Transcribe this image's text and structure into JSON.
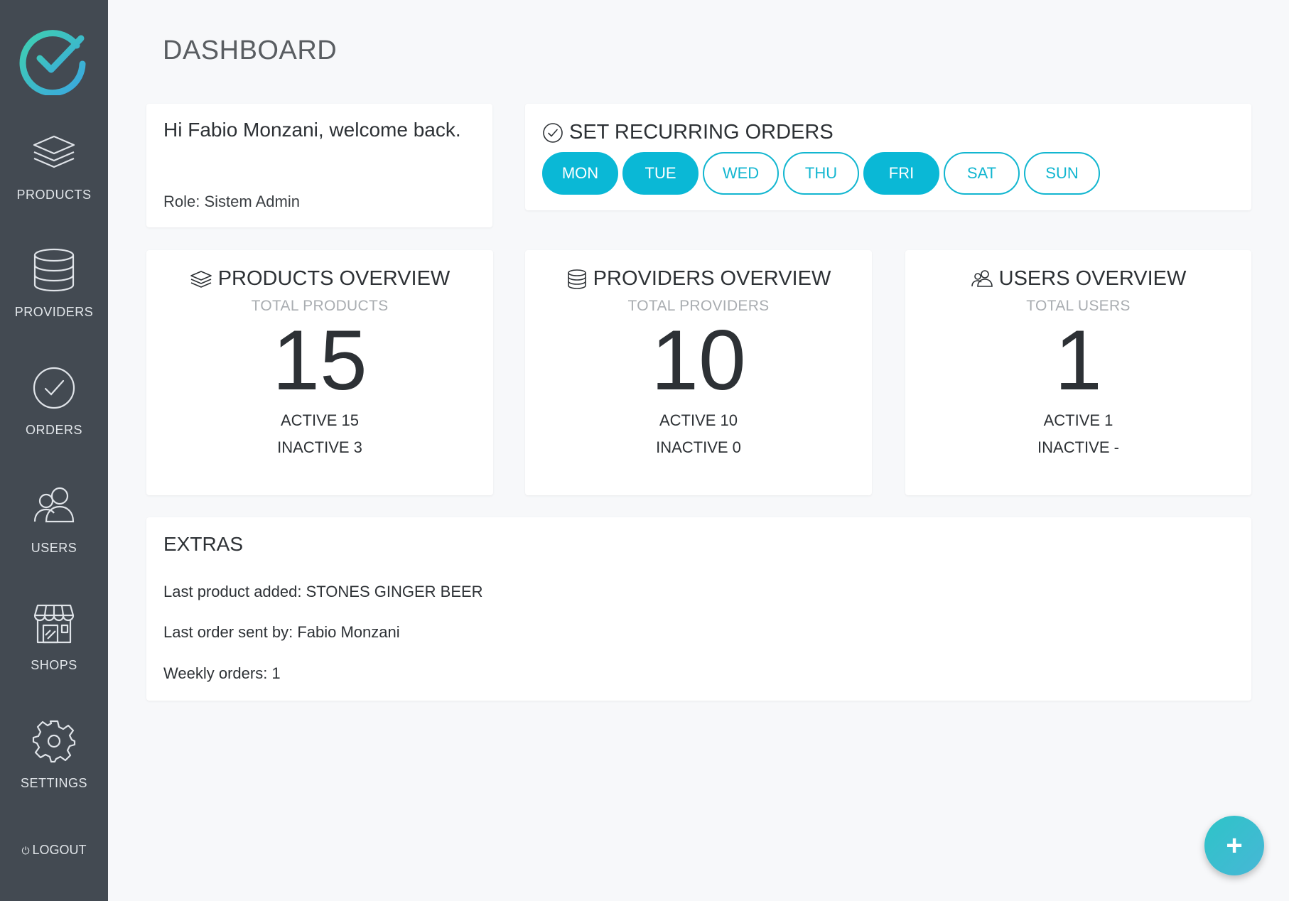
{
  "page": {
    "title": "DASHBOARD"
  },
  "sidebar": {
    "items": [
      {
        "label": "PRODUCTS",
        "icon": "layers-icon"
      },
      {
        "label": "PROVIDERS",
        "icon": "database-icon"
      },
      {
        "label": "ORDERS",
        "icon": "check-circle-icon"
      },
      {
        "label": "USERS",
        "icon": "users-icon"
      },
      {
        "label": "SHOPS",
        "icon": "shop-icon"
      },
      {
        "label": "SETTINGS",
        "icon": "gear-icon"
      }
    ],
    "logout": "LOGOUT"
  },
  "welcome": {
    "greeting": "Hi Fabio Monzani, welcome back.",
    "role": "Role: Sistem Admin"
  },
  "recurring": {
    "title": "SET RECURRING ORDERS",
    "days": [
      {
        "label": "MON",
        "selected": true
      },
      {
        "label": "TUE",
        "selected": true
      },
      {
        "label": "WED",
        "selected": false
      },
      {
        "label": "THU",
        "selected": false
      },
      {
        "label": "FRI",
        "selected": true
      },
      {
        "label": "SAT",
        "selected": false
      },
      {
        "label": "SUN",
        "selected": false
      }
    ]
  },
  "overview": {
    "products": {
      "title": "PRODUCTS OVERVIEW",
      "subtitle": "TOTAL PRODUCTS",
      "total": "15",
      "active": "ACTIVE 15",
      "inactive": "INACTIVE 3"
    },
    "providers": {
      "title": "PROVIDERS OVERVIEW",
      "subtitle": "TOTAL PROVIDERS",
      "total": "10",
      "active": "ACTIVE 10",
      "inactive": "INACTIVE 0"
    },
    "users": {
      "title": "USERS OVERVIEW",
      "subtitle": "TOTAL USERS",
      "total": "1",
      "active": "ACTIVE 1",
      "inactive": "INACTIVE -"
    }
  },
  "extras": {
    "title": "EXTRAS",
    "last_product": "Last product added: STONES GINGER BEER",
    "last_order": "Last order sent by: Fabio Monzani",
    "weekly_orders": "Weekly orders: 1"
  },
  "fab": {
    "label": "+"
  },
  "colors": {
    "accent": "#0ab8d6",
    "sidebar": "#434a52",
    "background": "#f7f8fa"
  }
}
